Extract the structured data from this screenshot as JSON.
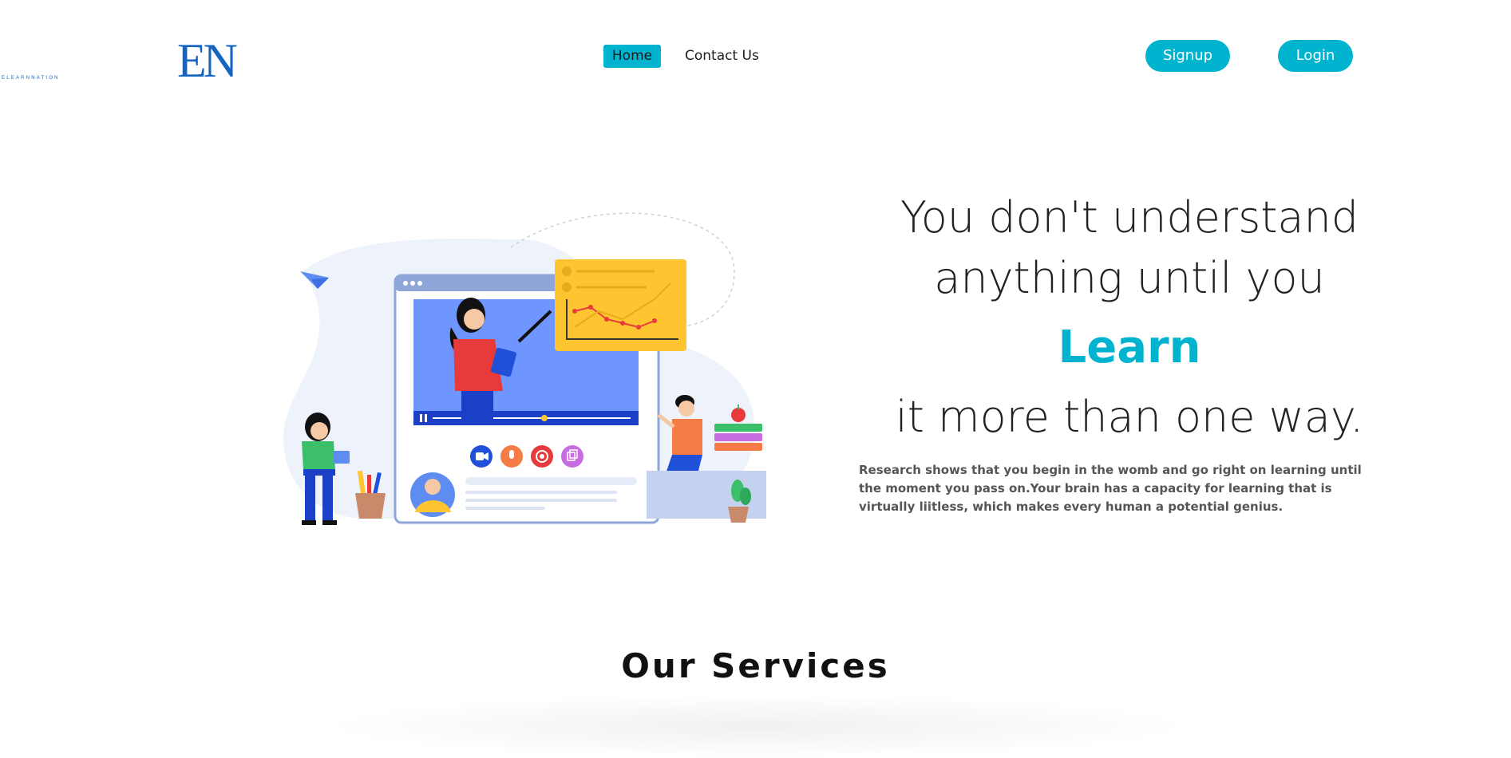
{
  "brand": {
    "logo_letters": "EN",
    "logo_subtext": "ELEARNNATION"
  },
  "nav": {
    "home_label": "Home",
    "contact_label": "Contact Us"
  },
  "auth": {
    "signup_label": "Signup",
    "login_label": "Login"
  },
  "hero": {
    "line1": "You don't understand",
    "line2": "anything until you",
    "highlight": "Learn",
    "line3": "it more than one way.",
    "description": "Research shows that you begin in the womb and go right on learning until the moment you pass on.Your brain has a capacity for learning that is virtually liitless, which makes every human a potential genius."
  },
  "services": {
    "title": "Our Services"
  },
  "colors": {
    "accent": "#00b3cf",
    "brand_blue": "#1565c0",
    "text_dark": "#222222",
    "text_muted": "#555555"
  },
  "illustration": {
    "icons": [
      "paper-plane-icon",
      "video-camera-icon",
      "microphone-icon",
      "record-icon",
      "copy-icon",
      "pause-icon",
      "apple-icon",
      "plant-icon"
    ]
  }
}
